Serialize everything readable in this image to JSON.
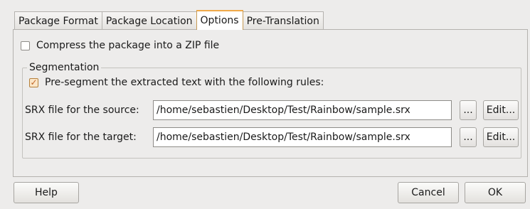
{
  "tabs": [
    {
      "label": "Package Format"
    },
    {
      "label": "Package Location"
    },
    {
      "label": "Options"
    },
    {
      "label": "Pre-Translation"
    }
  ],
  "active_tab": "Options",
  "options": {
    "compress_label": "Compress the package into a ZIP file",
    "compress_checked": false,
    "segmentation": {
      "title": "Segmentation",
      "presegment_label": "Pre-segment the extracted text with the following rules:",
      "presegment_checked": true,
      "source_label": "SRX file for the source:",
      "source_value": "/home/sebastien/Desktop/Test/Rainbow/sample.srx",
      "target_label": "SRX file for the target:",
      "target_value": "/home/sebastien/Desktop/Test/Rainbow/sample.srx",
      "browse_label": "...",
      "edit_label": "Edit..."
    }
  },
  "buttons": {
    "help": "Help",
    "cancel": "Cancel",
    "ok": "OK"
  }
}
